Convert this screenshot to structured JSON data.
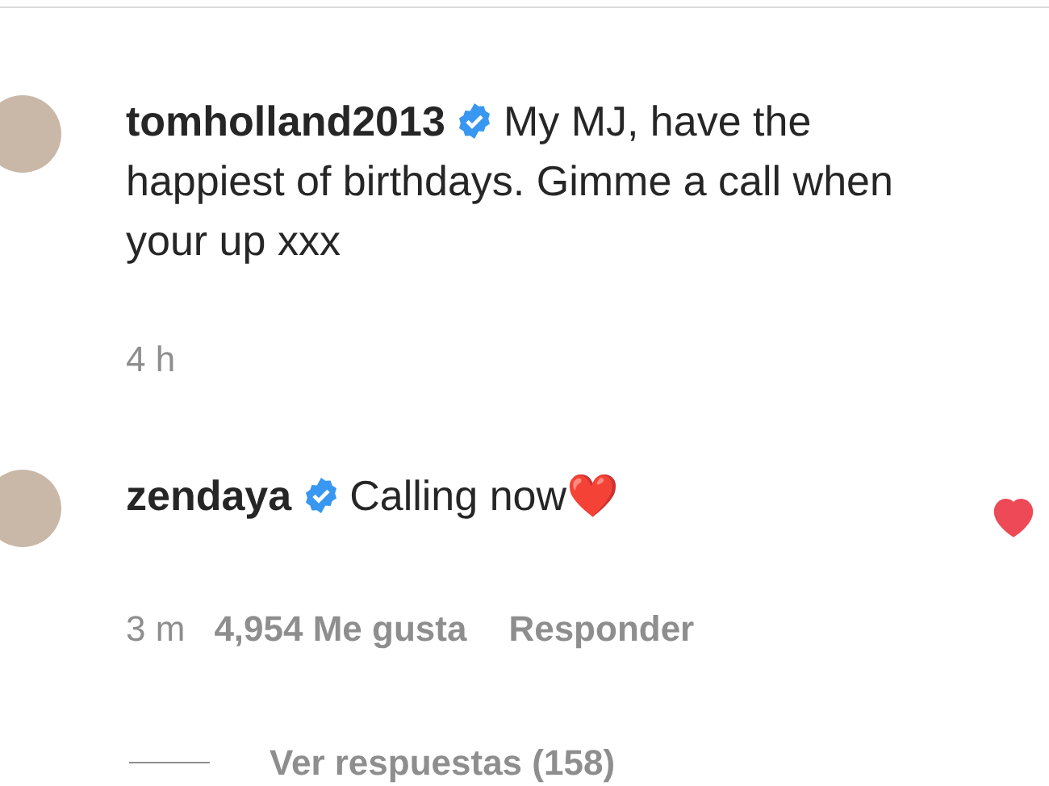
{
  "comments": [
    {
      "username": "tomholland2013",
      "verified": true,
      "text": "My MJ, have the happiest of birthdays. Gimme a call when your up xxx",
      "time": "4 h"
    },
    {
      "username": "zendaya",
      "verified": true,
      "text": "Calling now❤️",
      "time": "3 m",
      "likes": "4,954 Me gusta",
      "reply": "Responder",
      "liked": true,
      "replies": "Ver respuestas (158)"
    }
  ]
}
